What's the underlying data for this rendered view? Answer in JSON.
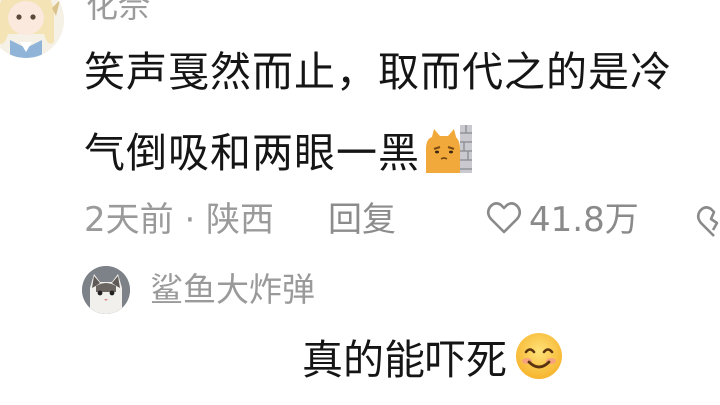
{
  "comment": {
    "author": "化佘",
    "avatar_icon": "anime-girl-avatar-icon",
    "lines": [
      "笑声戛然而止，取而代之的是冷",
      "气倒吸和两眼一黑"
    ],
    "emoji_icon": "cat-behind-wall-emoji-icon",
    "time_location": "2天前 · 陕西",
    "reply_label": "回复",
    "like_count": "41.8万",
    "like_icon": "heart-outline-icon",
    "dislike_icon": "broken-heart-icon"
  },
  "reply": {
    "author": "鲨鱼大炸弹",
    "avatar_icon": "cat-photo-avatar-icon",
    "text": "真的能吓死",
    "emoji_icon": "smiling-face-emoji-icon"
  },
  "colors": {
    "text_primary": "#151515",
    "text_secondary": "#9a9a9a",
    "background": "#ffffff",
    "cat_emoji": "#f2a93b"
  }
}
